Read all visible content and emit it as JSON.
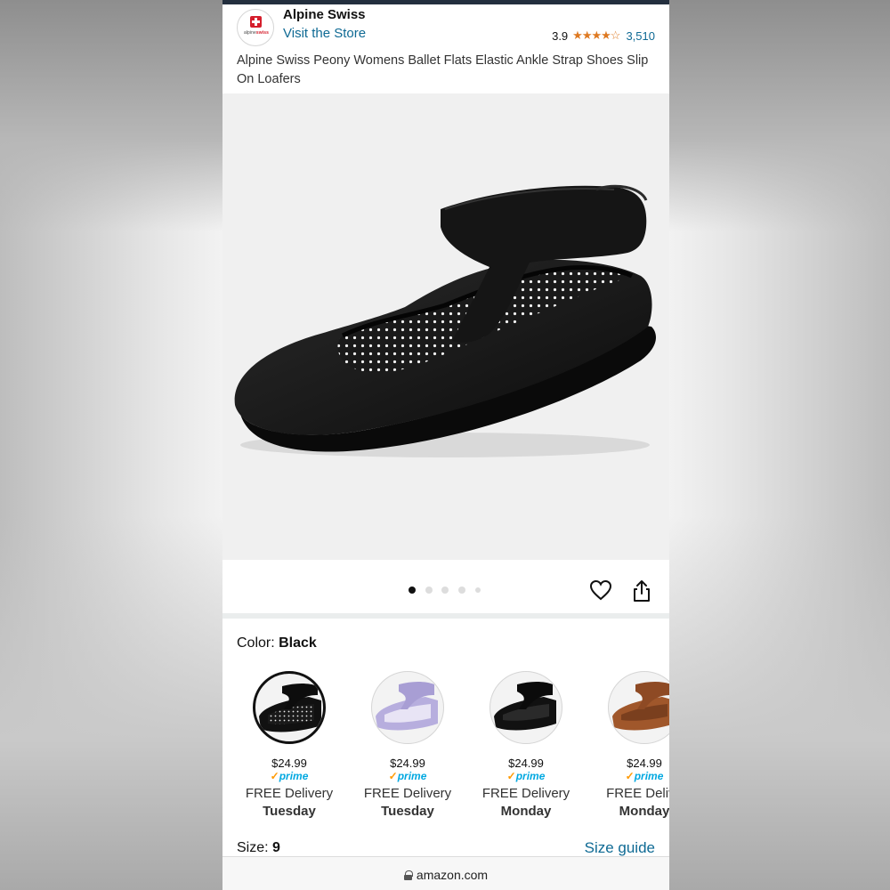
{
  "brand": {
    "logo_text_prefix": "alpine",
    "logo_text_suffix": "swiss",
    "name": "Alpine Swiss",
    "visit_store": "Visit the Store"
  },
  "rating": {
    "score": "3.9",
    "stars": 3.9,
    "count": "3,510",
    "star_color": "#de7921"
  },
  "product": {
    "title": "Alpine Swiss Peony Womens Ballet Flats Elastic Ankle Strap Shoes Slip On Loafers"
  },
  "carousel": {
    "total_dots": 5,
    "active_index": 0
  },
  "color": {
    "label": "Color: ",
    "selected": "Black"
  },
  "swatches": [
    {
      "variant": "black-polka",
      "price": "$24.99",
      "prime": "prime",
      "delivery": "FREE Delivery",
      "day": "Tuesday",
      "selected": true
    },
    {
      "variant": "lavender",
      "price": "$24.99",
      "prime": "prime",
      "delivery": "FREE Delivery",
      "day": "Tuesday",
      "selected": false
    },
    {
      "variant": "black",
      "price": "$24.99",
      "prime": "prime",
      "delivery": "FREE Delivery",
      "day": "Monday",
      "selected": false
    },
    {
      "variant": "brown",
      "price": "$24.99",
      "prime": "prime",
      "delivery": "FREE Delive",
      "day": "Monday",
      "selected": false
    }
  ],
  "size": {
    "label": "Size: ",
    "value": "9",
    "guide": "Size guide"
  },
  "browser": {
    "url": "amazon.com"
  },
  "colors": {
    "link": "#0f6a94",
    "prime": "#00a8e1",
    "prime_check": "#ff9900",
    "brand_red": "#d51e2c"
  }
}
